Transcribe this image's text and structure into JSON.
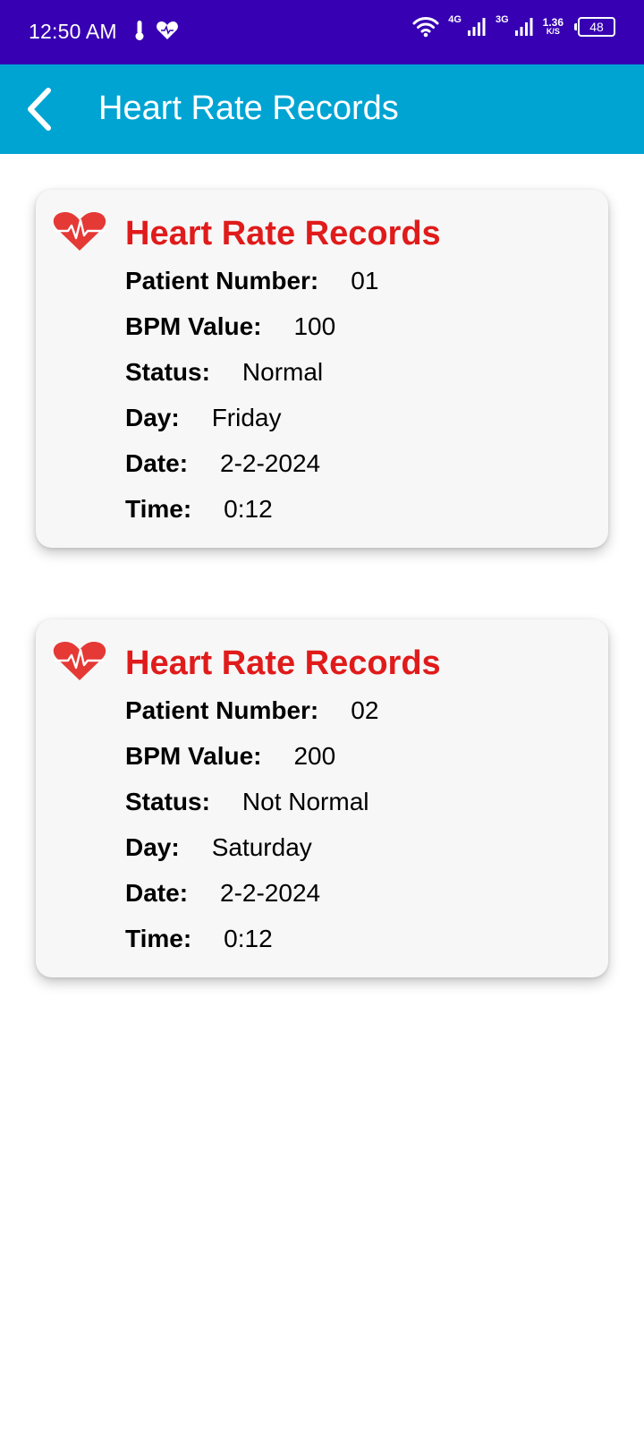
{
  "status_bar": {
    "time": "12:50 AM",
    "net1": "4G",
    "net2": "3G",
    "speed_value": "1.36",
    "speed_unit": "K/S",
    "battery": "48"
  },
  "app_bar": {
    "title": "Heart Rate Records"
  },
  "records": [
    {
      "title": "Heart Rate Records",
      "patient_label": "Patient Number:",
      "patient_value": "01",
      "bpm_label": "BPM Value:",
      "bpm_value": "100",
      "status_label": "Status:",
      "status_value": "Normal",
      "day_label": "Day:",
      "day_value": "Friday",
      "date_label": "Date:",
      "date_value": "2-2-2024",
      "time_label": "Time:",
      "time_value": "0:12"
    },
    {
      "title": "Heart Rate Records",
      "patient_label": "Patient Number:",
      "patient_value": "02",
      "bpm_label": "BPM Value:",
      "bpm_value": "200",
      "status_label": "Status:",
      "status_value": "Not Normal",
      "day_label": "Day:",
      "day_value": "Saturday",
      "date_label": "Date:",
      "date_value": "2-2-2024",
      "time_label": "Time:",
      "time_value": "0:12"
    }
  ],
  "colors": {
    "status_bar": "#3700b3",
    "app_bar": "#00a4d3",
    "card_title": "#e01b1b",
    "heart": "#e53935"
  }
}
